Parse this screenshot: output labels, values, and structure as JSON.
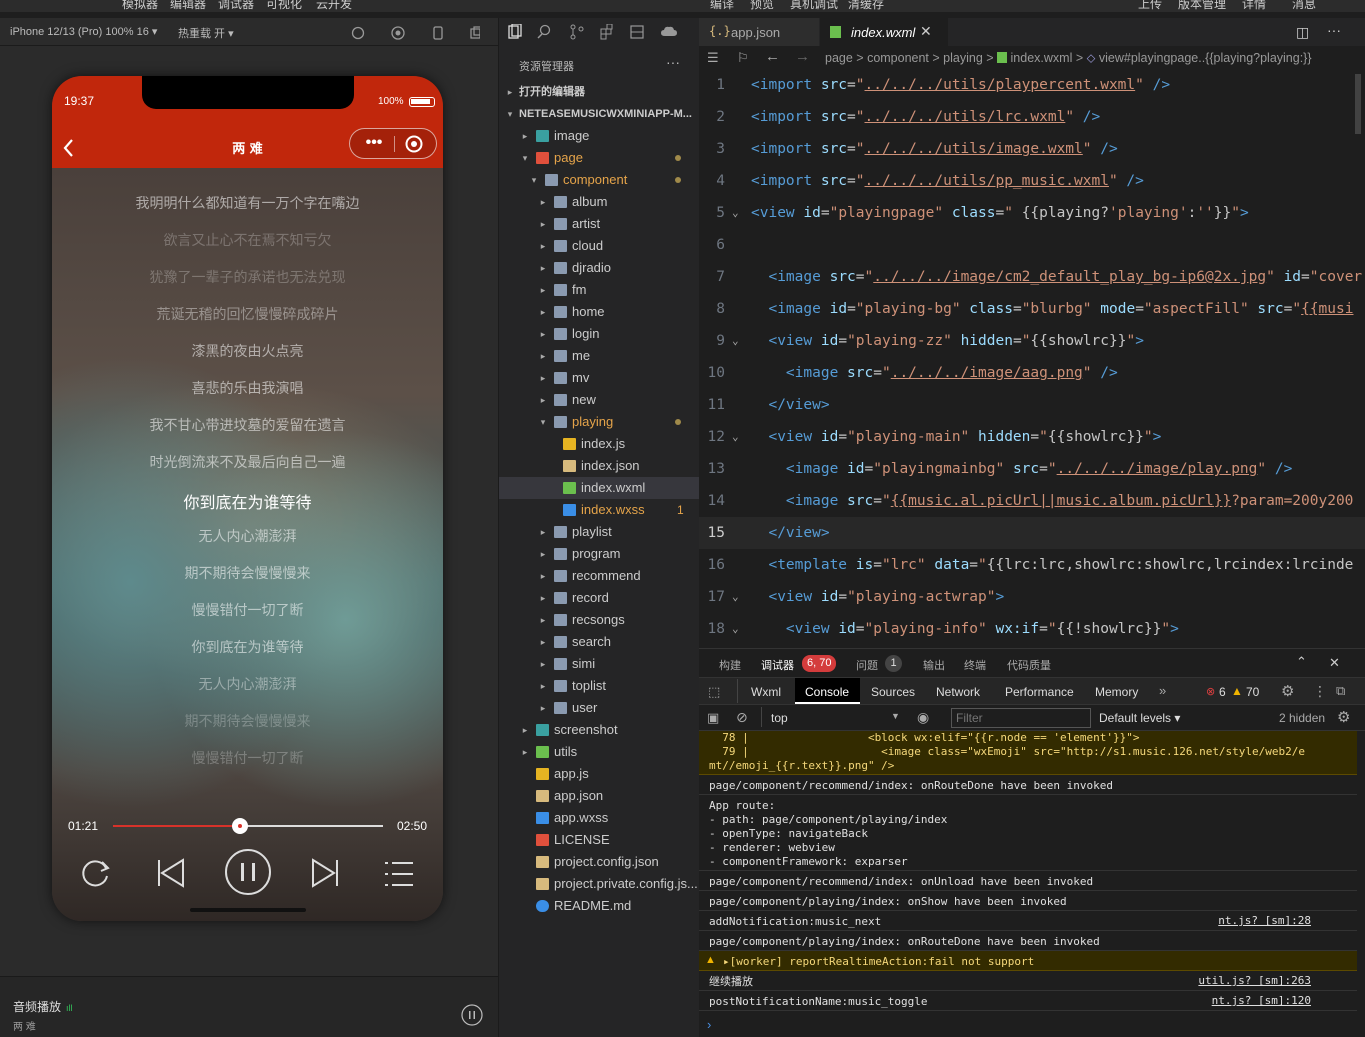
{
  "top_menu": [
    "模拟器",
    "编辑器",
    "调试器",
    "可视化",
    "云开发",
    "编译",
    "预览",
    "真机调试",
    "清缓存",
    "上传",
    "版本管理",
    "详情",
    "消息"
  ],
  "simulator": {
    "device": "iPhone 12/13 (Pro) 100% 16 ▾",
    "hot_reload": "热重载 开 ▾"
  },
  "phone": {
    "time": "19:37",
    "battery": "100%",
    "title": "两 难",
    "lyrics": [
      "我明明什么都知道有一万个字在嘴边",
      "欲言又止心不在焉不知亏欠",
      "犹豫了一辈子的承诺也无法兑现",
      "荒诞无稽的回忆慢慢碎成碎片",
      "漆黑的夜由火点亮",
      "喜悲的乐由我演唱",
      "我不甘心带进坟墓的爱留在遗言",
      "时光倒流来不及最后向自己一遍",
      "你到底在为谁等待",
      "无人内心潮澎湃",
      "期不期待会慢慢慢来",
      "慢慢错付一切了断",
      "你到底在为谁等待",
      "无人内心潮澎湃",
      "期不期待会慢慢慢来",
      "慢慢错付一切了断"
    ],
    "current_time": "01:21",
    "total_time": "02:50",
    "progress": 0.47
  },
  "audio": {
    "label": "音频播放",
    "song": "两 难"
  },
  "explorer": {
    "title": "资源管理器",
    "open_editors": "打开的编辑器",
    "project": "NETEASEMUSICWXMINIAPP-M...",
    "items": [
      {
        "name": "image",
        "depth": 1,
        "type": "folder",
        "open": false
      },
      {
        "name": "page",
        "depth": 1,
        "type": "folder",
        "open": true,
        "color": "#e5a44a",
        "dot": true
      },
      {
        "name": "component",
        "depth": 2,
        "type": "folder",
        "open": true,
        "color": "#e5a44a",
        "dot": true
      },
      {
        "name": "album",
        "depth": 3,
        "type": "folder"
      },
      {
        "name": "artist",
        "depth": 3,
        "type": "folder"
      },
      {
        "name": "cloud",
        "depth": 3,
        "type": "folder"
      },
      {
        "name": "djradio",
        "depth": 3,
        "type": "folder"
      },
      {
        "name": "fm",
        "depth": 3,
        "type": "folder"
      },
      {
        "name": "home",
        "depth": 3,
        "type": "folder"
      },
      {
        "name": "login",
        "depth": 3,
        "type": "folder"
      },
      {
        "name": "me",
        "depth": 3,
        "type": "folder"
      },
      {
        "name": "mv",
        "depth": 3,
        "type": "folder"
      },
      {
        "name": "new",
        "depth": 3,
        "type": "folder"
      },
      {
        "name": "playing",
        "depth": 3,
        "type": "folder",
        "open": true,
        "color": "#e5a44a",
        "dot": true
      },
      {
        "name": "index.js",
        "depth": 4,
        "type": "js"
      },
      {
        "name": "index.json",
        "depth": 4,
        "type": "json"
      },
      {
        "name": "index.wxml",
        "depth": 4,
        "type": "wxml",
        "selected": true
      },
      {
        "name": "index.wxss",
        "depth": 4,
        "type": "wxss",
        "color": "#e5a44a",
        "badge": "1"
      },
      {
        "name": "playlist",
        "depth": 3,
        "type": "folder"
      },
      {
        "name": "program",
        "depth": 3,
        "type": "folder"
      },
      {
        "name": "recommend",
        "depth": 3,
        "type": "folder"
      },
      {
        "name": "record",
        "depth": 3,
        "type": "folder"
      },
      {
        "name": "recsongs",
        "depth": 3,
        "type": "folder"
      },
      {
        "name": "search",
        "depth": 3,
        "type": "folder"
      },
      {
        "name": "simi",
        "depth": 3,
        "type": "folder"
      },
      {
        "name": "toplist",
        "depth": 3,
        "type": "folder"
      },
      {
        "name": "user",
        "depth": 3,
        "type": "folder"
      },
      {
        "name": "screenshot",
        "depth": 1,
        "type": "folder"
      },
      {
        "name": "utils",
        "depth": 1,
        "type": "folder"
      },
      {
        "name": "app.js",
        "depth": 1,
        "type": "js"
      },
      {
        "name": "app.json",
        "depth": 1,
        "type": "json"
      },
      {
        "name": "app.wxss",
        "depth": 1,
        "type": "wxss"
      },
      {
        "name": "LICENSE",
        "depth": 1,
        "type": "license"
      },
      {
        "name": "project.config.json",
        "depth": 1,
        "type": "json"
      },
      {
        "name": "project.private.config.js...",
        "depth": 1,
        "type": "json"
      },
      {
        "name": "README.md",
        "depth": 1,
        "type": "info"
      }
    ]
  },
  "editor": {
    "tabs": [
      "app.json",
      "index.wxml"
    ],
    "breadcrumb": [
      "page",
      "component",
      "playing",
      "index.wxml",
      "view#playingpage..{{playing?playing:}}"
    ],
    "lines": [
      {
        "n": "1",
        "html": "<span class=t>&lt;import</span> <span class=a>src</span>=<span class=s>\"</span><span class=u>../../../utils/playpercent.wxml</span><span class=s>\"</span> <span class=t>/&gt;</span>"
      },
      {
        "n": "2",
        "html": "<span class=t>&lt;import</span> <span class=a>src</span>=<span class=s>\"</span><span class=u>../../../utils/lrc.wxml</span><span class=s>\"</span> <span class=t>/&gt;</span>"
      },
      {
        "n": "3",
        "html": "<span class=t>&lt;import</span> <span class=a>src</span>=<span class=s>\"</span><span class=u>../../../utils/image.wxml</span><span class=s>\"</span> <span class=t>/&gt;</span>"
      },
      {
        "n": "4",
        "html": "<span class=t>&lt;import</span> <span class=a>src</span>=<span class=s>\"</span><span class=u>../../../utils/pp_music.wxml</span><span class=s>\"</span> <span class=t>/&gt;</span>"
      },
      {
        "n": "5",
        "fold": true,
        "html": "<span class=t>&lt;view</span> <span class=a>id</span>=<span class=s>\"playingpage\"</span> <span class=a>class</span>=<span class=s>\" </span>{{playing?<span class=s>'playing'</span>:<span class=s>''</span>}}<span class=s>\"</span><span class=t>&gt;</span>"
      },
      {
        "n": "6",
        "html": ""
      },
      {
        "n": "7",
        "html": "  <span class=t>&lt;image</span> <span class=a>src</span>=<span class=s>\"</span><span class=u>../../../image/cm2_default_play_bg-ip6@2x.jpg</span><span class=s>\"</span> <span class=a>id</span>=<span class=s>\"cover</span>"
      },
      {
        "n": "8",
        "html": "  <span class=t>&lt;image</span> <span class=a>id</span>=<span class=s>\"playing-bg\"</span> <span class=a>class</span>=<span class=s>\"blurbg\"</span> <span class=a>mode</span>=<span class=s>\"aspectFill\"</span> <span class=a>src</span>=<span class=s>\"</span><span class=u>{{musi</span>"
      },
      {
        "n": "9",
        "fold": true,
        "html": "  <span class=t>&lt;view</span> <span class=a>id</span>=<span class=s>\"playing-zz\"</span> <span class=a>hidden</span>=<span class=s>\"</span>{{showlrc}}<span class=s>\"</span><span class=t>&gt;</span>"
      },
      {
        "n": "10",
        "html": "    <span class=t>&lt;image</span> <span class=a>src</span>=<span class=s>\"</span><span class=u>../../../image/aag.png</span><span class=s>\"</span> <span class=t>/&gt;</span>"
      },
      {
        "n": "11",
        "html": "  <span class=t>&lt;/view&gt;</span>"
      },
      {
        "n": "12",
        "fold": true,
        "html": "  <span class=t>&lt;view</span> <span class=a>id</span>=<span class=s>\"playing-main\"</span> <span class=a>hidden</span>=<span class=s>\"</span>{{showlrc}}<span class=s>\"</span><span class=t>&gt;</span>"
      },
      {
        "n": "13",
        "html": "    <span class=t>&lt;image</span> <span class=a>id</span>=<span class=s>\"playingmainbg\"</span> <span class=a>src</span>=<span class=s>\"</span><span class=u>../../../image/play.png</span><span class=s>\"</span> <span class=t>/&gt;</span>"
      },
      {
        "n": "14",
        "html": "    <span class=t>&lt;image</span> <span class=a>src</span>=<span class=s>\"</span><span class=u>{{music.al.picUrl||music.album.picUrl}}</span><span class=s>?param=200y200</span>"
      },
      {
        "n": "15",
        "active": true,
        "html": "  <span class=t>&lt;/view&gt;</span>"
      },
      {
        "n": "16",
        "html": "  <span class=t>&lt;template</span> <span class=a>is</span>=<span class=s>\"lrc\"</span> <span class=a>data</span>=<span class=s>\"</span>{{lrc:lrc,showlrc:showlrc,lrcindex:lrcinde"
      },
      {
        "n": "17",
        "fold": true,
        "html": "  <span class=t>&lt;view</span> <span class=a>id</span>=<span class=s>\"playing-actwrap\"</span><span class=t>&gt;</span>"
      },
      {
        "n": "18",
        "fold": true,
        "html": "    <span class=t>&lt;view</span> <span class=a>id</span>=<span class=s>\"playing-info\"</span> <span class=a>wx:if</span>=<span class=s>\"</span>{{!showlrc}}<span class=s>\"</span><span class=t>&gt;</span>"
      }
    ]
  },
  "debug": {
    "top_tabs": [
      "构建",
      "调试器",
      "问题",
      "输出",
      "终端",
      "代码质量"
    ],
    "debugger_badge": "6, 70",
    "problems_badge": "1",
    "devtools_tabs": [
      "Wxml",
      "Console",
      "Sources",
      "Network",
      "Performance",
      "Memory"
    ],
    "errors": "6",
    "warnings": "70",
    "context": "top",
    "filter_placeholder": "Filter",
    "levels": "Default levels ▾",
    "hidden": "2 hidden",
    "logs": [
      {
        "text": "  78 |                  <block wx:elif=\"{{r.node == 'element'}}\">\n  79 |                    <image class=\"wxEmoji\" src=\"http://s1.music.126.net/style/web2/e\nmt//emoji_{{r.text}}.png\" />",
        "kind": "warncode",
        "h": 44
      },
      {
        "text": "page/component/recommend/index: onRouteDone have been invoked",
        "kind": "log",
        "h": 20
      },
      {
        "text": "App route:\n- path: page/component/playing/index\n- openType: navigateBack\n- renderer: webview\n- componentFramework: exparser",
        "kind": "log",
        "h": 76
      },
      {
        "text": "page/component/recommend/index: onUnload have been invoked",
        "kind": "log",
        "h": 20
      },
      {
        "text": "page/component/playing/index: onShow have been invoked",
        "kind": "log",
        "h": 20
      },
      {
        "text": "addNotification:music_next",
        "kind": "log",
        "link": "nt.js? [sm]:28",
        "h": 20
      },
      {
        "text": "page/component/playing/index: onRouteDone have been invoked",
        "kind": "log",
        "h": 20
      },
      {
        "text": "▸[worker] reportRealtimeAction:fail not support",
        "kind": "warn",
        "h": 20
      },
      {
        "text": "继续播放",
        "kind": "log",
        "link": "util.js? [sm]:263",
        "h": 20
      },
      {
        "text": "postNotificationName:music_toggle",
        "kind": "log",
        "link": "nt.js? [sm]:120",
        "h": 20
      }
    ]
  }
}
